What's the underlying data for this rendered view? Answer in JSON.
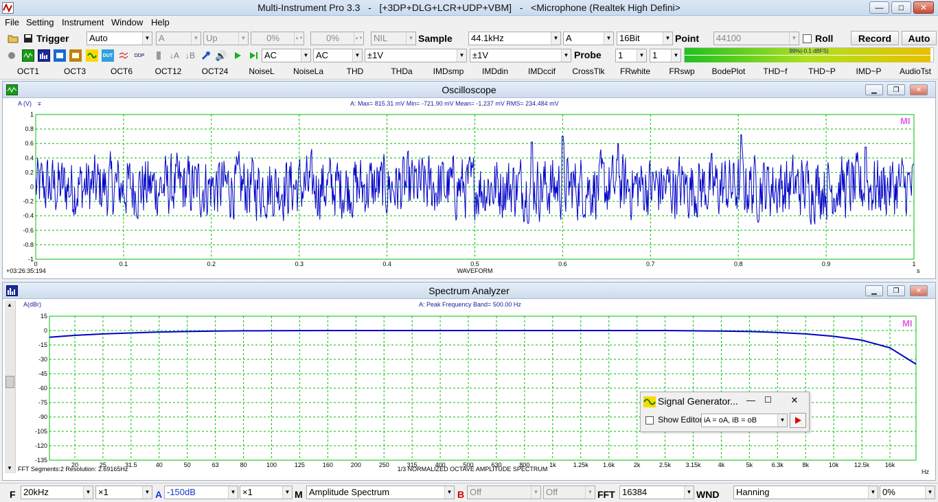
{
  "titlebar": {
    "title": "Multi-Instrument Pro 3.3   -   [+3DP+DLG+LCR+UDP+VBM]   -   <Microphone (Realtek High Defini>",
    "min": "—",
    "max": "□",
    "close": "✕"
  },
  "menu": [
    "File",
    "Setting",
    "Instrument",
    "Window",
    "Help"
  ],
  "toolbar1": {
    "trigger_label": "Trigger",
    "trigger_mode": "Auto",
    "channel": "A",
    "slope": "Up",
    "level1": "0%",
    "level2": "0%",
    "nil": "NIL",
    "sample_label": "Sample",
    "sample_rate": "44.1kHz",
    "input_channel": "A",
    "bits": "16Bit",
    "point_label": "Point",
    "points": "44100",
    "roll_label": "Roll",
    "record_label": "Record",
    "auto_label": "Auto"
  },
  "toolbar2": {
    "coupling_a": "AC",
    "coupling_b": "AC",
    "range_a": "±1V",
    "range_b": "±1V",
    "probe_label": "Probe",
    "probe_a": "1",
    "probe_b": "1",
    "level_meter_text": "99%(-0.1 dBFS)",
    "level_meter_fraction": 0.99
  },
  "functions": [
    "OCT1",
    "OCT3",
    "OCT6",
    "OCT12",
    "OCT24",
    "NoiseL",
    "NoiseLa",
    "THD",
    "THDa",
    "IMDsmp",
    "IMDdin",
    "IMDccif",
    "CrossTlk",
    "FRwhite",
    "FRswp",
    "BodePlot",
    "THD~f",
    "THD~P",
    "IMD~P",
    "AudioTst"
  ],
  "oscilloscope": {
    "title": "Oscilloscope",
    "ylabel": "A (V)",
    "stats": "A: Max=   815.31 mV  Min=   -721.90 mV  Mean=      -1.237 mV  RMS=    234.484 mV",
    "xlabel": "WAVEFORM",
    "xunit": "s",
    "timestamp": "+03:26:35:194",
    "logo": "MI"
  },
  "spectrum": {
    "title": "Spectrum Analyzer",
    "ylabel": "A(dBr)",
    "stats": "A: Peak Frequency Band=     500.00    Hz",
    "xlabel": "1/3 NORMALIZED OCTAVE AMPLITUDE SPECTRUM",
    "xunit": "Hz",
    "footer": "FFT  Segments:2     Resolution: 2.69165Hz",
    "logo": "MI"
  },
  "chart_data": [
    {
      "type": "line",
      "title": "Oscilloscope",
      "ylabel": "A (V)",
      "xlabel": "WAVEFORM",
      "xlim": [
        0,
        1
      ],
      "ylim": [
        -1,
        1
      ],
      "xticks": [
        "0",
        "0.1",
        "0.2",
        "0.3",
        "0.4",
        "0.5",
        "0.6",
        "0.7",
        "0.8",
        "0.9",
        "1"
      ],
      "yticks": [
        "1",
        "0.8",
        "0.6",
        "0.4",
        "0.2",
        "0",
        "-0.2",
        "-0.4",
        "-0.6",
        "-0.8",
        "-1"
      ],
      "grid": true,
      "series": [
        {
          "color": "#0000c8",
          "max": 0.81531,
          "min": -0.7219,
          "mean": -0.001237,
          "rms": 0.234484,
          "peaks": [
            {
              "x": 0.565,
              "y": 0.62
            },
            {
              "x": 0.803,
              "y": 0.72
            },
            {
              "x": 0.6,
              "y": 0.7
            },
            {
              "x": 0.945,
              "y": 0.55
            },
            {
              "x": 0.663,
              "y": 0.6
            }
          ]
        }
      ]
    },
    {
      "type": "line",
      "title": "Spectrum Analyzer",
      "ylabel": "A(dBr)",
      "xlabel": "1/3 NORMALIZED OCTAVE AMPLITUDE SPECTRUM",
      "ylim": [
        -135,
        15
      ],
      "yticks": [
        "15",
        "0",
        "-15",
        "-30",
        "-45",
        "-60",
        "-75",
        "-90",
        "-105",
        "-120",
        "-135"
      ],
      "x": [
        "20",
        "25",
        "31.5",
        "40",
        "50",
        "63",
        "80",
        "100",
        "125",
        "160",
        "200",
        "250",
        "315",
        "400",
        "500",
        "630",
        "800",
        "1k",
        "1.25k",
        "1.6k",
        "2k",
        "2.5k",
        "3.15k",
        "4k",
        "5k",
        "6.3k",
        "8k",
        "10k",
        "12.5k",
        "16k"
      ],
      "grid": true,
      "series": [
        {
          "color": "#0000c8",
          "values": [
            -5,
            -3.5,
            -2.5,
            -1.5,
            -1,
            -0.6,
            -0.3,
            -0.2,
            -0.1,
            0,
            0,
            0,
            0,
            0,
            0,
            0,
            0,
            0,
            0,
            0,
            0,
            0,
            -0.3,
            -0.6,
            -1,
            -2,
            -3.5,
            -6,
            -10,
            -18
          ]
        }
      ]
    }
  ],
  "siggen": {
    "title": "Signal Generator...",
    "show_editor": "Show Editor",
    "mapping": "iA = oA, iB = oB"
  },
  "statusbar": {
    "f_label": "F",
    "freq_range": "20kHz",
    "x_zoom": "×1",
    "a_label": "A",
    "a_range": "-150dB",
    "a_zoom": "×1",
    "m_label": "M",
    "mode": "Amplitude Spectrum",
    "b_label": "B",
    "b_range": "Off",
    "b_zoom": "Off",
    "fft_label": "FFT",
    "fft_size": "16384",
    "wnd_label": "WND",
    "window": "Hanning",
    "overlap": "0%"
  }
}
